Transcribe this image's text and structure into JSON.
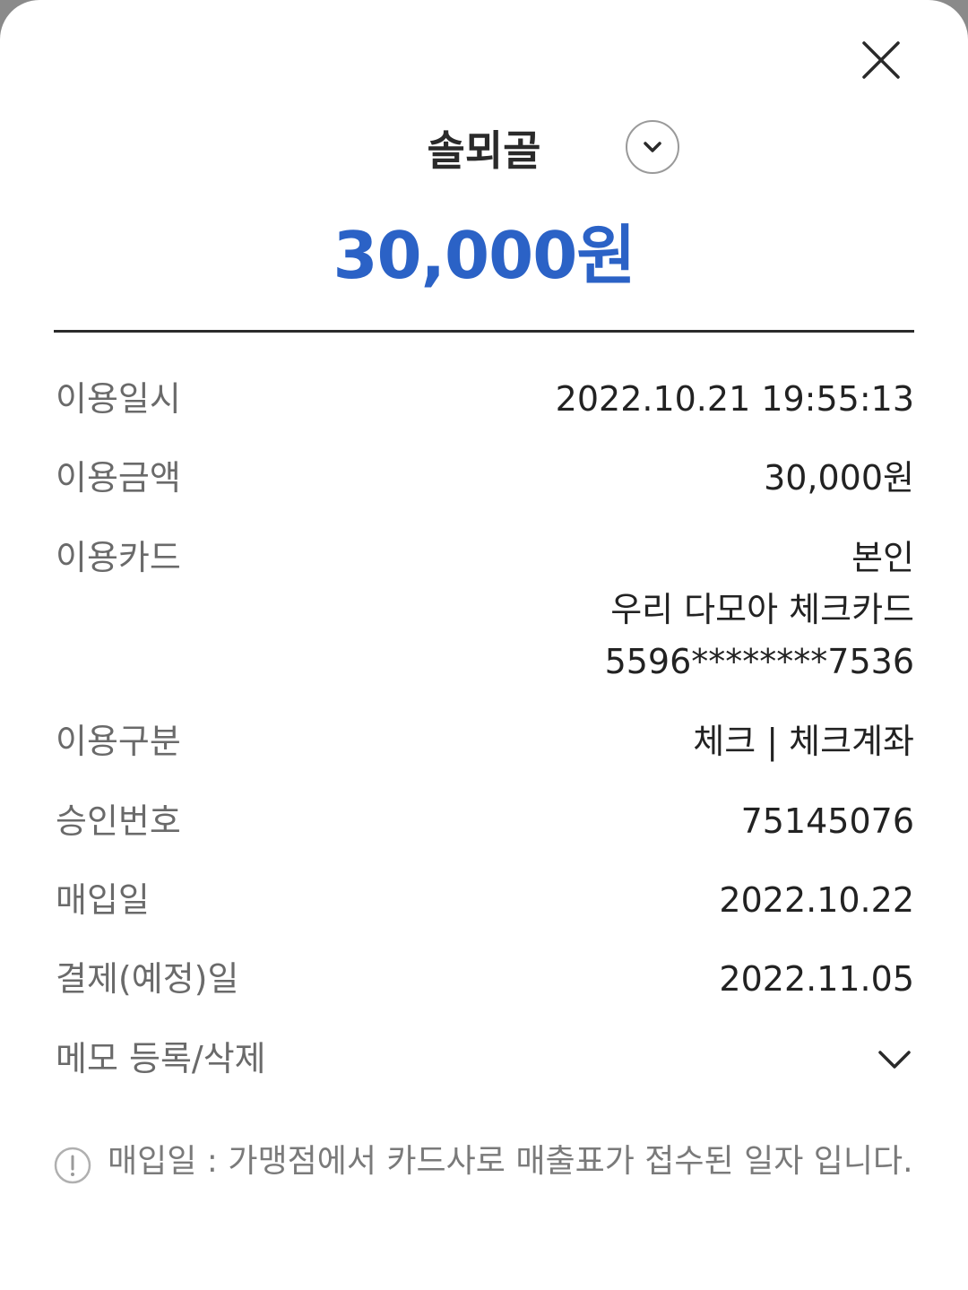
{
  "header": {
    "merchant_name": "솔뫼골",
    "close_icon": "close-icon",
    "expand_icon": "chevron-down-icon",
    "amount": "30,000원",
    "amount_color": "#2b62c6"
  },
  "details": [
    {
      "label": "이용일시",
      "values": [
        "2022.10.21 19:55:13"
      ]
    },
    {
      "label": "이용금액",
      "values": [
        "30,000원"
      ]
    },
    {
      "label": "이용카드",
      "values": [
        "본인",
        "우리 다모아 체크카드",
        "5596********7536"
      ]
    },
    {
      "label": "이용구분",
      "values": [
        "체크 | 체크계좌"
      ]
    },
    {
      "label": "승인번호",
      "values": [
        "75145076"
      ]
    },
    {
      "label": "매입일",
      "values": [
        "2022.10.22"
      ]
    },
    {
      "label": "결제(예정)일",
      "values": [
        "2022.11.05"
      ]
    }
  ],
  "memo": {
    "label": "메모 등록/삭제",
    "icon": "chevron-down-icon"
  },
  "notice": {
    "icon": "info-icon",
    "text": "매입일 : 가맹점에서 카드사로 매출표가 접수된 일자 입니다."
  }
}
